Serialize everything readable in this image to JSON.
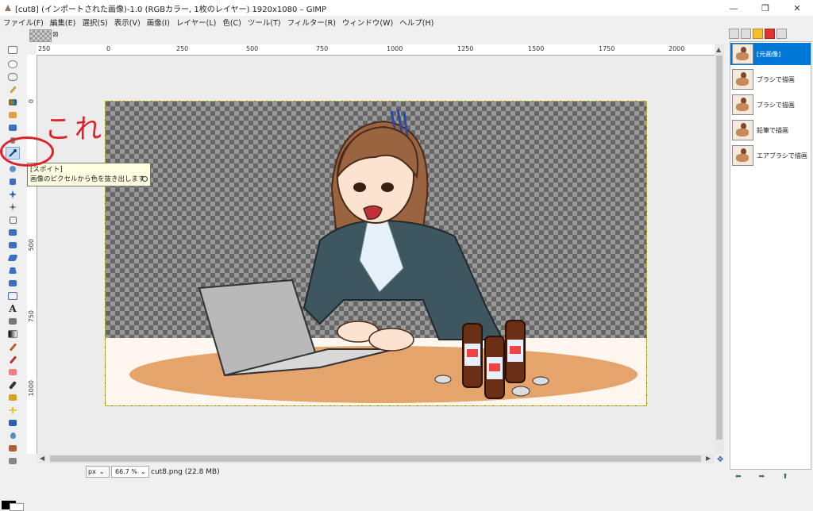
{
  "window": {
    "title": "[cut8] (インポートされた画像)-1.0 (RGBカラー, 1枚のレイヤー) 1920x1080 – GIMP"
  },
  "menu": [
    "ファイル(F)",
    "編集(E)",
    "選択(S)",
    "表示(V)",
    "画像(I)",
    "レイヤー(L)",
    "色(C)",
    "ツール(T)",
    "フィルター(R)",
    "ウィンドウ(W)",
    "ヘルプ(H)"
  ],
  "rulers": {
    "horizontal": [
      "250",
      "0",
      "250",
      "500",
      "750",
      "1000",
      "1250",
      "1500",
      "1750",
      "2000"
    ],
    "vertical": [
      "0",
      "250",
      "500",
      "750",
      "1000"
    ]
  },
  "tooltip": {
    "title": "[スポイト]",
    "description": "画像のピクセルから色を抜き出します"
  },
  "annotation": {
    "text": "これ",
    "color": "#e0202a"
  },
  "status": {
    "unit": "px",
    "zoom": "66.7 %",
    "file": "cut8.png (22.8 MB)"
  },
  "layers": [
    {
      "name": "[元画像]",
      "selected": true
    },
    {
      "name": "ブラシで描画",
      "selected": false
    },
    {
      "name": "ブラシで描画",
      "selected": false
    },
    {
      "name": "鉛筆で描画",
      "selected": false
    },
    {
      "name": "エアブラシで描画",
      "selected": false
    }
  ],
  "colors": {
    "selection": "#0078d7",
    "foreground": "#000000",
    "background": "#ffffff"
  }
}
